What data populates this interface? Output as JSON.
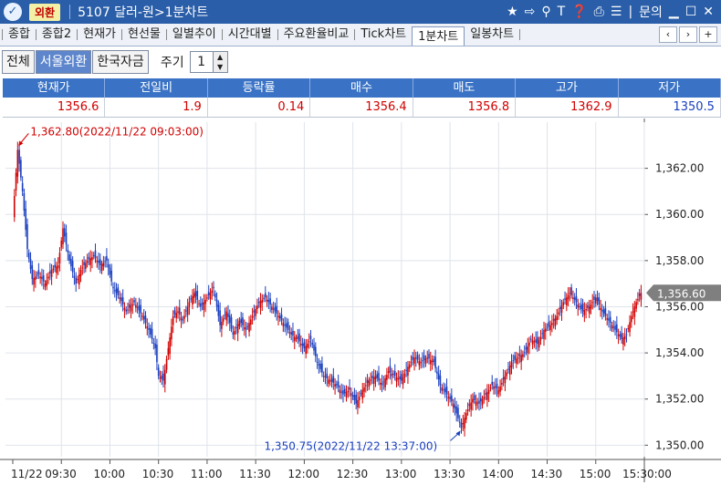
{
  "titlebar": {
    "tag": "외환",
    "title": "5107 달러-원>1분차트",
    "icons": [
      "star-icon",
      "export-icon",
      "link-icon",
      "text-icon",
      "help-icon",
      "print-icon",
      "list-icon"
    ],
    "inquiry": "문의"
  },
  "tabs": [
    "종합",
    "종합2",
    "현재가",
    "현선물",
    "일별추이",
    "시간대별",
    "주요환율비교",
    "Tick차트",
    "1분차트",
    "일봉차트"
  ],
  "active_tab": "1분차트",
  "toolbar": {
    "buttons": [
      "전체",
      "서울외환",
      "한국자금"
    ],
    "selected": "서울외환",
    "period_label": "주기",
    "period_value": "1"
  },
  "quote": {
    "headers": [
      "현재가",
      "전일비",
      "등락률",
      "매수",
      "매도",
      "고가",
      "저가"
    ],
    "values": [
      "1356.6",
      "1.9",
      "0.14",
      "1356.4",
      "1356.8",
      "1362.9",
      "1350.5"
    ]
  },
  "colors": {
    "up": "#d10000",
    "down": "#1a3fbf",
    "header": "#3a73c5"
  },
  "chart_data": {
    "type": "candlestick",
    "date": "2022/11/22",
    "x_tick_labels": [
      "11/22",
      "09:30",
      "10:00",
      "10:30",
      "11:00",
      "11:30",
      "12:00",
      "12:30",
      "13:00",
      "13:30",
      "14:00",
      "14:30",
      "15:00",
      "15:30:00"
    ],
    "y_tick_labels": [
      "1,362.00",
      "1,360.00",
      "1,358.00",
      "1,356.00",
      "1,354.00",
      "1,352.00",
      "1,350.00"
    ],
    "ylim": [
      1349.5,
      1364.0
    ],
    "current_price_label": "1,356.60",
    "current_price": 1356.6,
    "high_annotation": "1,362.80(2022/11/22 09:03:00)",
    "high": {
      "time": "09:03",
      "value": 1362.8
    },
    "low_annotation": "1,350.75(2022/11/22 13:37:00)",
    "low": {
      "time": "13:37",
      "value": 1350.75
    },
    "price_path": [
      [
        "09:00",
        1359.8
      ],
      [
        "09:03",
        1362.8
      ],
      [
        "09:06",
        1361.0
      ],
      [
        "09:09",
        1358.5
      ],
      [
        "09:12",
        1357.2
      ],
      [
        "09:16",
        1357.4
      ],
      [
        "09:20",
        1357.0
      ],
      [
        "09:24",
        1357.6
      ],
      [
        "09:28",
        1357.8
      ],
      [
        "09:31",
        1359.4
      ],
      [
        "09:35",
        1358.0
      ],
      [
        "09:39",
        1357.0
      ],
      [
        "09:42",
        1357.6
      ],
      [
        "09:46",
        1358.0
      ],
      [
        "09:50",
        1358.2
      ],
      [
        "09:54",
        1357.8
      ],
      [
        "09:58",
        1358.0
      ],
      [
        "10:02",
        1356.8
      ],
      [
        "10:06",
        1356.4
      ],
      [
        "10:10",
        1355.8
      ],
      [
        "10:15",
        1356.2
      ],
      [
        "10:20",
        1355.6
      ],
      [
        "10:24",
        1355.0
      ],
      [
        "10:28",
        1354.2
      ],
      [
        "10:30",
        1353.0
      ],
      [
        "10:33",
        1352.8
      ],
      [
        "10:36",
        1354.2
      ],
      [
        "10:39",
        1355.6
      ],
      [
        "10:42",
        1355.8
      ],
      [
        "10:45",
        1355.4
      ],
      [
        "10:49",
        1356.2
      ],
      [
        "10:52",
        1356.6
      ],
      [
        "10:56",
        1356.0
      ],
      [
        "11:00",
        1356.4
      ],
      [
        "11:04",
        1356.8
      ],
      [
        "11:08",
        1355.2
      ],
      [
        "11:12",
        1355.8
      ],
      [
        "11:16",
        1354.8
      ],
      [
        "11:20",
        1355.4
      ],
      [
        "11:24",
        1355.0
      ],
      [
        "11:28",
        1355.6
      ],
      [
        "11:32",
        1356.2
      ],
      [
        "11:36",
        1356.4
      ],
      [
        "11:40",
        1356.0
      ],
      [
        "11:44",
        1355.6
      ],
      [
        "11:48",
        1355.2
      ],
      [
        "11:52",
        1354.8
      ],
      [
        "11:56",
        1354.6
      ],
      [
        "12:00",
        1354.2
      ],
      [
        "12:04",
        1354.6
      ],
      [
        "12:08",
        1353.6
      ],
      [
        "12:12",
        1353.0
      ],
      [
        "12:16",
        1352.8
      ],
      [
        "12:20",
        1352.6
      ],
      [
        "12:24",
        1352.2
      ],
      [
        "12:28",
        1352.4
      ],
      [
        "12:32",
        1351.8
      ],
      [
        "12:36",
        1352.4
      ],
      [
        "12:40",
        1352.8
      ],
      [
        "12:44",
        1353.0
      ],
      [
        "12:48",
        1352.6
      ],
      [
        "12:52",
        1353.2
      ],
      [
        "12:56",
        1353.0
      ],
      [
        "13:00",
        1352.8
      ],
      [
        "13:04",
        1353.4
      ],
      [
        "13:08",
        1353.8
      ],
      [
        "13:12",
        1353.6
      ],
      [
        "13:16",
        1353.8
      ],
      [
        "13:20",
        1353.6
      ],
      [
        "13:24",
        1352.6
      ],
      [
        "13:28",
        1352.2
      ],
      [
        "13:32",
        1351.8
      ],
      [
        "13:37",
        1350.75
      ],
      [
        "13:40",
        1351.4
      ],
      [
        "13:44",
        1352.0
      ],
      [
        "13:48",
        1351.8
      ],
      [
        "13:52",
        1352.2
      ],
      [
        "13:56",
        1352.6
      ],
      [
        "14:00",
        1352.4
      ],
      [
        "14:04",
        1353.0
      ],
      [
        "14:08",
        1353.6
      ],
      [
        "14:12",
        1353.8
      ],
      [
        "14:16",
        1354.0
      ],
      [
        "14:20",
        1354.6
      ],
      [
        "14:24",
        1354.4
      ],
      [
        "14:28",
        1355.0
      ],
      [
        "14:32",
        1355.2
      ],
      [
        "14:36",
        1355.6
      ],
      [
        "14:40",
        1356.2
      ],
      [
        "14:44",
        1356.6
      ],
      [
        "14:48",
        1356.2
      ],
      [
        "14:52",
        1355.8
      ],
      [
        "14:56",
        1356.0
      ],
      [
        "15:00",
        1356.4
      ],
      [
        "15:04",
        1355.8
      ],
      [
        "15:08",
        1355.4
      ],
      [
        "15:12",
        1355.0
      ],
      [
        "15:16",
        1354.6
      ],
      [
        "15:19",
        1354.8
      ],
      [
        "15:22",
        1355.6
      ],
      [
        "15:25",
        1356.2
      ],
      [
        "15:28",
        1356.6
      ]
    ]
  }
}
